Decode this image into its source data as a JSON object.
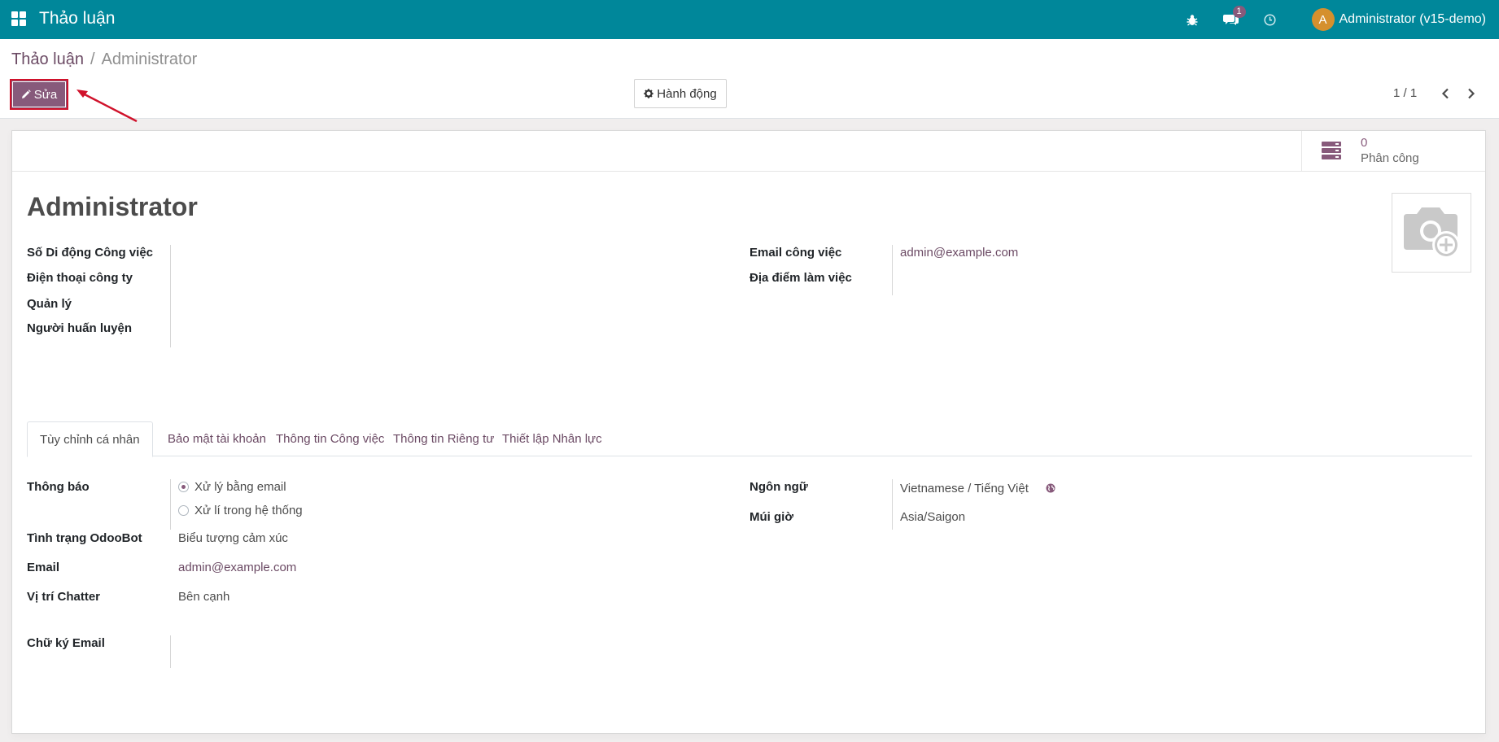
{
  "navbar": {
    "app_title": "Thảo luận",
    "messages_badge": "1",
    "user_initial": "A",
    "user_name": "Administrator (v15-demo)"
  },
  "breadcrumb": {
    "parent": "Thảo luận",
    "separator": "/",
    "current": "Administrator"
  },
  "toolbar": {
    "edit_label": "Sửa",
    "action_label": "Hành động",
    "pager": "1 / 1"
  },
  "stat_button": {
    "value": "0",
    "label": "Phân công"
  },
  "employee": {
    "name": "Administrator"
  },
  "fields_left": [
    {
      "label": "Số Di động Công việc",
      "value": ""
    },
    {
      "label": "Điện thoại công ty",
      "value": ""
    },
    {
      "label": "Quản lý",
      "value": ""
    },
    {
      "label": "Người huấn luyện",
      "value": ""
    }
  ],
  "fields_right": [
    {
      "label": "Email công việc",
      "value": "admin@example.com"
    },
    {
      "label": "Địa điểm làm việc",
      "value": ""
    }
  ],
  "tabs": [
    {
      "label": "Tùy chỉnh cá nhân",
      "active": true
    },
    {
      "label": "Bảo mật tài khoản",
      "active": false
    },
    {
      "label": "Thông tin Công việc",
      "active": false
    },
    {
      "label": "Thông tin Riêng tư",
      "active": false
    },
    {
      "label": "Thiết lập Nhân lực",
      "active": false
    }
  ],
  "preferences": {
    "notification_label": "Thông báo",
    "notification_options": [
      {
        "label": "Xử lý bằng email",
        "checked": true
      },
      {
        "label": "Xử lí trong hệ thống",
        "checked": false
      }
    ],
    "odoobot_label": "Tình trạng OdooBot",
    "odoobot_value": "Biểu tượng cảm xúc",
    "email_label": "Email",
    "email_value": "admin@example.com",
    "chatter_label": "Vị trí Chatter",
    "chatter_value": "Bên cạnh",
    "signature_label": "Chữ ký Email",
    "signature_value": "",
    "language_label": "Ngôn ngữ",
    "language_value": "Vietnamese / Tiếng Việt",
    "timezone_label": "Múi giờ",
    "timezone_value": "Asia/Saigon"
  },
  "colors": {
    "navbar": "#00879a",
    "primary": "#875a7b",
    "annotation": "#d0122b"
  }
}
